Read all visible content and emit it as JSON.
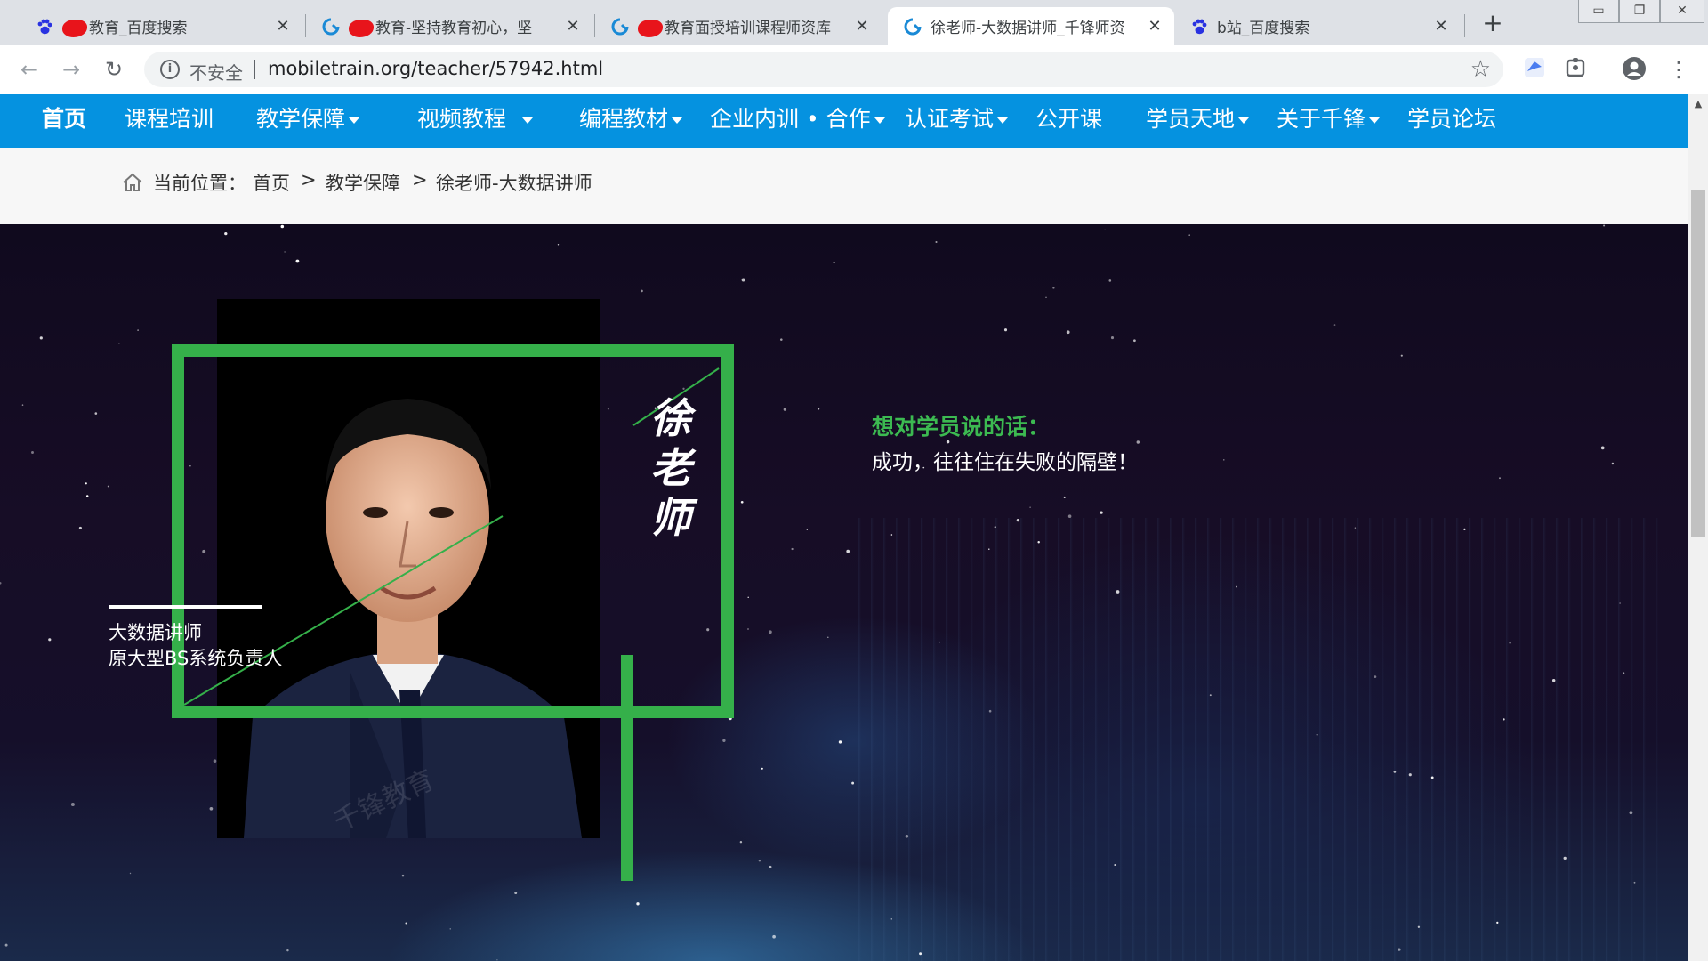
{
  "browser": {
    "tabs": [
      {
        "title": "教育_百度搜索",
        "favicon": "baidu-paw-icon",
        "redacted": true,
        "active": false
      },
      {
        "title": "教育-坚持教育初心，坚",
        "favicon": "qianfeng-logo-icon",
        "redacted": true,
        "active": false
      },
      {
        "title": "教育面授培训课程师资库",
        "favicon": "qianfeng-logo-icon",
        "redacted": true,
        "active": false
      },
      {
        "title": "徐老师-大数据讲师_千锋师资",
        "favicon": "qianfeng-logo-icon",
        "redacted": false,
        "active": true
      },
      {
        "title": "b站_百度搜索",
        "favicon": "baidu-paw-icon",
        "redacted": false,
        "active": false
      }
    ],
    "new_tab_icon": "plus-icon",
    "address": {
      "security_label": "不安全",
      "url": "mobiletrain.org/teacher/57942.html"
    }
  },
  "site": {
    "nav": [
      {
        "label": "首页",
        "dropdown": false
      },
      {
        "label": "课程培训",
        "dropdown": false
      },
      {
        "label": "教学保障",
        "dropdown": true
      },
      {
        "label": "视频教程",
        "dropdown": true
      },
      {
        "label": "编程教材",
        "dropdown": true
      },
      {
        "label": "企业内训 • 合作",
        "dropdown": true
      },
      {
        "label": "认证考试",
        "dropdown": true
      },
      {
        "label": "公开课",
        "dropdown": false
      },
      {
        "label": "学员天地",
        "dropdown": true
      },
      {
        "label": "关于千锋",
        "dropdown": true
      },
      {
        "label": "学员论坛",
        "dropdown": false
      }
    ],
    "breadcrumb": {
      "prefix": "当前位置：",
      "items": [
        "首页",
        "教学保障",
        "徐老师-大数据讲师"
      ],
      "separator": ">"
    },
    "teacher": {
      "calligraphy_name": [
        "徐",
        "老",
        "师"
      ],
      "title_line1": "大数据讲师",
      "title_line2": "原大型BS系统负责人",
      "quote_heading": "想对学员说的话：",
      "quote_text": "成功，往往住在失败的隔壁！",
      "watermark": "千锋教育 mobiletrain.org"
    }
  },
  "colors": {
    "nav_blue": "#0592e0",
    "accent_green": "#35b04a",
    "quote_green": "#3cba51",
    "hero_dark": "#150f2a"
  }
}
